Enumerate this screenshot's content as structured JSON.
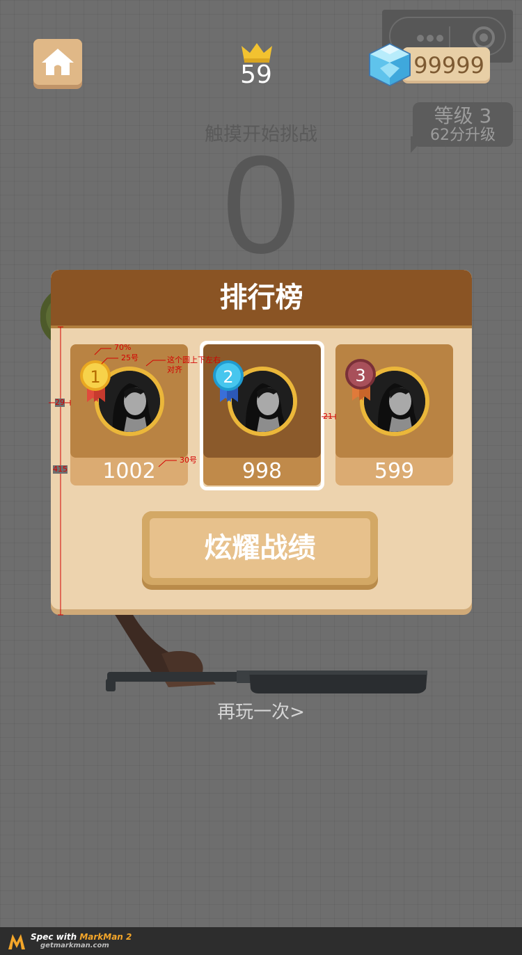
{
  "header": {
    "home_icon": "home-icon",
    "crown_icon": "crown-icon",
    "best_score": "59",
    "diamond_icon": "diamond-icon",
    "diamonds": "99999"
  },
  "capsule": {
    "menu_icon": "more-dots-icon",
    "close_icon": "target-close-icon"
  },
  "level": {
    "title": "等级 3",
    "subtitle": "62分升级"
  },
  "background": {
    "touch_hint": "触摸开始挑战",
    "current_score": "0"
  },
  "leaderboard": {
    "title": "排行榜",
    "entries": [
      {
        "rank": "1",
        "score": "1002",
        "medal_color": "#f3c83a",
        "ribbon_color": "#e04a3c"
      },
      {
        "rank": "2",
        "score": "998",
        "medal_color": "#3fbfe8",
        "ribbon_color": "#3a6fd8"
      },
      {
        "rank": "3",
        "score": "599",
        "medal_color": "#a8505a",
        "ribbon_color": "#e07a3a"
      }
    ],
    "share_button": "炫耀战绩"
  },
  "replay_link": "再玩一次>",
  "annotations": {
    "percent": "70%",
    "medal_size": "25号",
    "align_note_1": "这个圆上下左右",
    "align_note_2": "对齐",
    "score_font": "30号",
    "left_margin": "29",
    "card_gap": "21",
    "panel_height": "415"
  },
  "footer": {
    "spec_with": "Spec with ",
    "brand": "MarkMan 2",
    "site": "getmarkman.com"
  },
  "colors": {
    "panel_header": "#8a5424",
    "panel_body": "#edd3ae",
    "card": "#b98343",
    "card_selected": "#8b5a2b",
    "avatar_ring": "#ebb73a",
    "annotation": "#d40000"
  }
}
